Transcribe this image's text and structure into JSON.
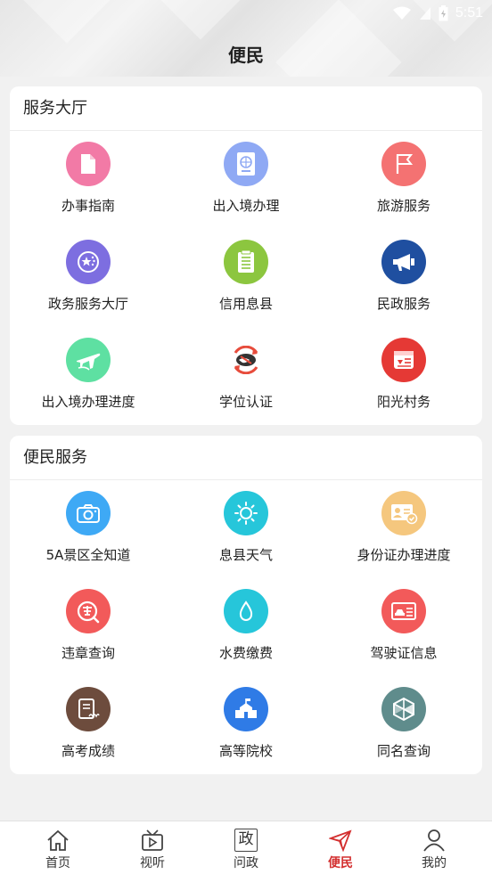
{
  "status": {
    "time": "5:51"
  },
  "header": {
    "title": "便民"
  },
  "service_hall": {
    "title": "服务大厅",
    "items": [
      {
        "label": "办事指南",
        "icon": "document-icon",
        "color": "#f27aa6"
      },
      {
        "label": "出入境办理",
        "icon": "passport-icon",
        "color": "#8fa9f4"
      },
      {
        "label": "旅游服务",
        "icon": "flag-icon",
        "color": "#f47272"
      },
      {
        "label": "政务服务大厅",
        "icon": "star-emblem-icon",
        "color": "#7d6ee0"
      },
      {
        "label": "信用息县",
        "icon": "notepad-icon",
        "color": "#8cc63f"
      },
      {
        "label": "民政服务",
        "icon": "megaphone-icon",
        "color": "#1f4fa0"
      },
      {
        "label": "出入境办理进度",
        "icon": "airplane-icon",
        "color": "#5ee0a2"
      },
      {
        "label": "学位认证",
        "icon": "handshake-icon",
        "color": "#e74c3c"
      },
      {
        "label": "阳光村务",
        "icon": "bulletin-icon",
        "color": "#e53935"
      }
    ]
  },
  "convenience": {
    "title": "便民服务",
    "items": [
      {
        "label": "5A景区全知道",
        "icon": "camera-icon",
        "color": "#3ea9f5"
      },
      {
        "label": "息县天气",
        "icon": "sun-icon",
        "color": "#26c6da"
      },
      {
        "label": "身份证办理进度",
        "icon": "id-card-icon",
        "color": "#f5c77e"
      },
      {
        "label": "违章查询",
        "icon": "violation-icon",
        "color": "#f25a5a"
      },
      {
        "label": "水费缴费",
        "icon": "water-drop-icon",
        "color": "#26c6da"
      },
      {
        "label": "驾驶证信息",
        "icon": "license-icon",
        "color": "#f25a5a"
      },
      {
        "label": "高考成绩",
        "icon": "score-sheet-icon",
        "color": "#6d4c3d"
      },
      {
        "label": "高等院校",
        "icon": "school-icon",
        "color": "#2f7be6"
      },
      {
        "label": "同名查询",
        "icon": "hexagon-icon",
        "color": "#5f8c8c"
      }
    ]
  },
  "tabbar": {
    "active_color": "#d32f2f",
    "items": [
      {
        "label": "首页",
        "icon": "home-icon"
      },
      {
        "label": "视听",
        "icon": "tv-icon"
      },
      {
        "label": "问政",
        "icon": "zheng-icon",
        "glyph": "政"
      },
      {
        "label": "便民",
        "icon": "send-icon",
        "active": true
      },
      {
        "label": "我的",
        "icon": "user-icon"
      }
    ]
  }
}
